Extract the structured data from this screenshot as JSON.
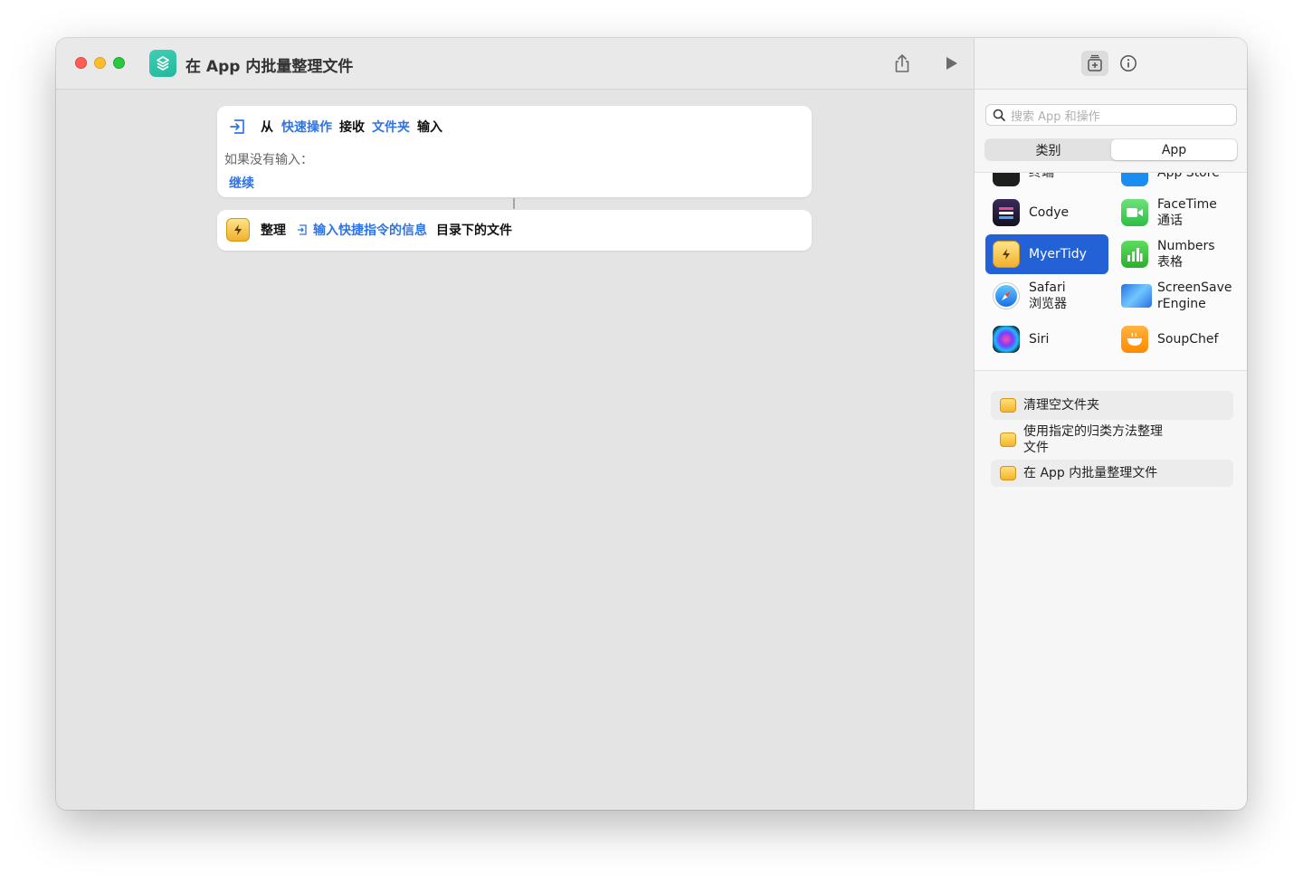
{
  "window": {
    "title": "在 App 内批量整理文件"
  },
  "toolbar": {
    "share_icon": "share-icon",
    "run_icon": "play-icon",
    "library_icon": "add-to-library-icon",
    "info_icon": "info-icon"
  },
  "workflow": {
    "receive": {
      "from": "从",
      "source": "快速操作",
      "receive": "接收",
      "type": "文件夹",
      "input": "输入",
      "no_input": "如果没有输入：",
      "continue": "继续"
    },
    "organize": {
      "verb": "整理",
      "variable": "输入快捷指令的信息",
      "suffix": "目录下的文件"
    }
  },
  "sidebar": {
    "search_placeholder": "搜索 App 和操作",
    "segments": [
      "类别",
      "App"
    ],
    "active_segment": "App",
    "apps": [
      {
        "name": "Codye",
        "icon": "codye-icon"
      },
      {
        "name": "FaceTime\n通话",
        "icon": "facetime-icon"
      },
      {
        "name": "MyerTidy",
        "icon": "myertidy-icon",
        "selected": true
      },
      {
        "name": "Numbers\n表格",
        "icon": "numbers-icon"
      },
      {
        "name": "Safari\n浏览器",
        "icon": "safari-icon"
      },
      {
        "name": "ScreenSave\nrEngine",
        "icon": "screensaver-icon"
      },
      {
        "name": "Siri",
        "icon": "siri-icon"
      },
      {
        "name": "SoupChef",
        "icon": "soupchef-icon"
      }
    ],
    "partial_apps": [
      "终端",
      "App Store"
    ],
    "actions": [
      "清理空文件夹",
      "使用指定的归类方法整理\n文件",
      "在 App 内批量整理文件"
    ]
  },
  "colors": {
    "accent": "#2262d6",
    "token": "#2f74e6"
  }
}
